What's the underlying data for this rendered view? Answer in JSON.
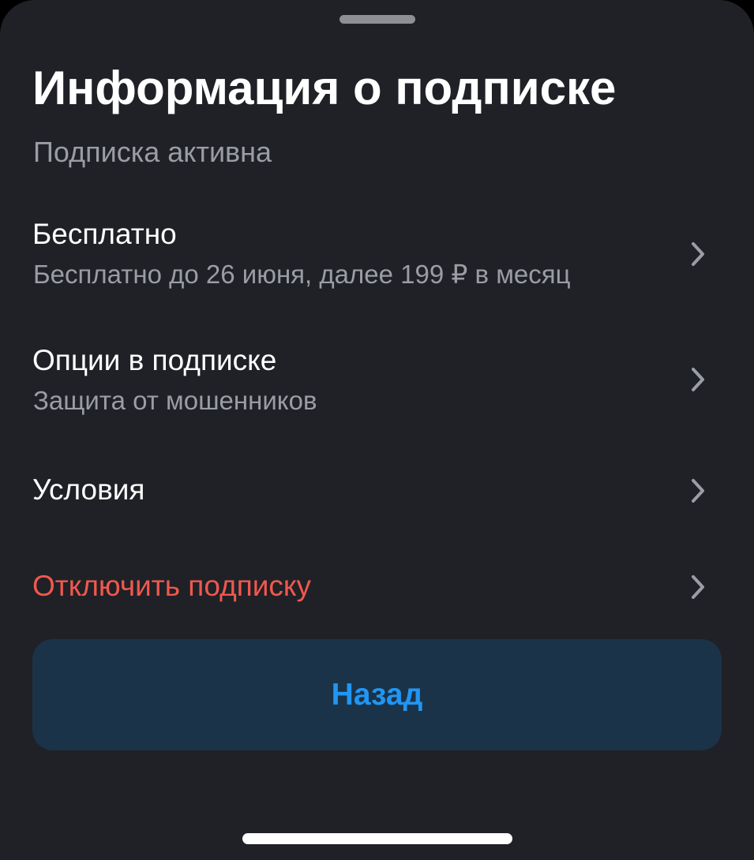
{
  "sheet": {
    "title": "Информация о подписке",
    "status": "Подписка активна"
  },
  "rows": [
    {
      "title": "Бесплатно",
      "subtitle": "Бесплатно до 26 июня, далее 199 ₽ в месяц",
      "icon": "chevron-right-icon"
    },
    {
      "title": "Опции в подписке",
      "subtitle": "Защита от мошенников",
      "icon": "chevron-right-icon"
    },
    {
      "title": "Условия",
      "icon": "chevron-right-icon"
    },
    {
      "title": "Отключить подписку",
      "icon": "chevron-right-icon",
      "color": "#f0584f"
    }
  ],
  "back_button": {
    "label": "Назад",
    "color": "#2196f3",
    "background": "#1b3348"
  },
  "colors": {
    "background": "#1f2126",
    "primary_text": "#ffffff",
    "secondary_text": "#9a9da3",
    "danger": "#f0584f"
  }
}
